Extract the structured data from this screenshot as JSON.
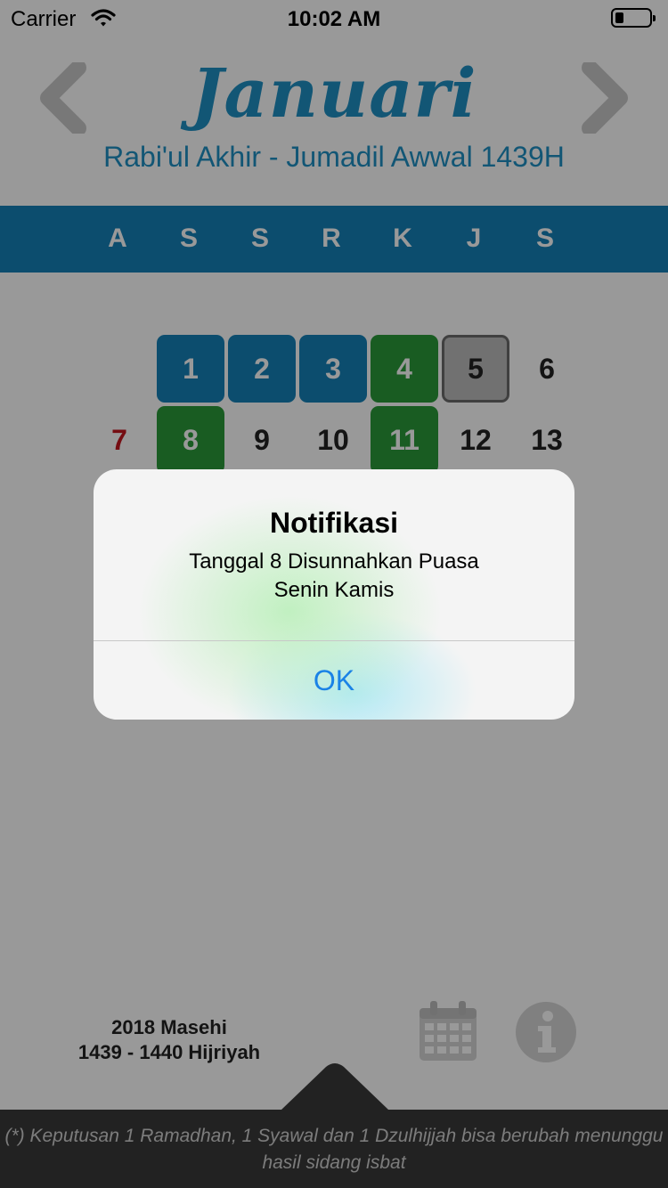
{
  "status_bar": {
    "carrier": "Carrier",
    "time": "10:02 AM"
  },
  "header": {
    "month": "Januari",
    "hijri": "Rabi'ul Akhir - Jumadil Awwal 1439H"
  },
  "weekdays": [
    "A",
    "S",
    "S",
    "R",
    "K",
    "J",
    "S"
  ],
  "days": [
    {
      "label": "1",
      "style": "blue"
    },
    {
      "label": "2",
      "style": "blue"
    },
    {
      "label": "3",
      "style": "blue"
    },
    {
      "label": "4",
      "style": "green"
    },
    {
      "label": "5",
      "style": "today"
    },
    {
      "label": "6",
      "style": "plain"
    },
    {
      "label": "7",
      "style": "sunday"
    },
    {
      "label": "8",
      "style": "green"
    },
    {
      "label": "9",
      "style": "plain"
    },
    {
      "label": "10",
      "style": "plain"
    },
    {
      "label": "11",
      "style": "green"
    },
    {
      "label": "12",
      "style": "plain"
    },
    {
      "label": "13",
      "style": "plain"
    }
  ],
  "footer": {
    "year_masehi": "2018 Masehi",
    "year_hijri": "1439 - 1440 Hijriyah",
    "note": "(*) Keputusan 1 Ramadhan, 1 Syawal dan 1 Dzulhijjah bisa berubah menunggu hasil sidang isbat",
    "icons": [
      "calendar-icon",
      "info-icon"
    ]
  },
  "alert": {
    "title": "Notifikasi",
    "message_line1": "Tanggal 8 Disunnahkan Puasa",
    "message_line2": "Senin Kamis",
    "ok_label": "OK"
  },
  "colors": {
    "primary": "#1580b8",
    "green": "#2b9a3a",
    "sunday_red": "#c4171f",
    "ok_blue": "#1a82e6"
  }
}
